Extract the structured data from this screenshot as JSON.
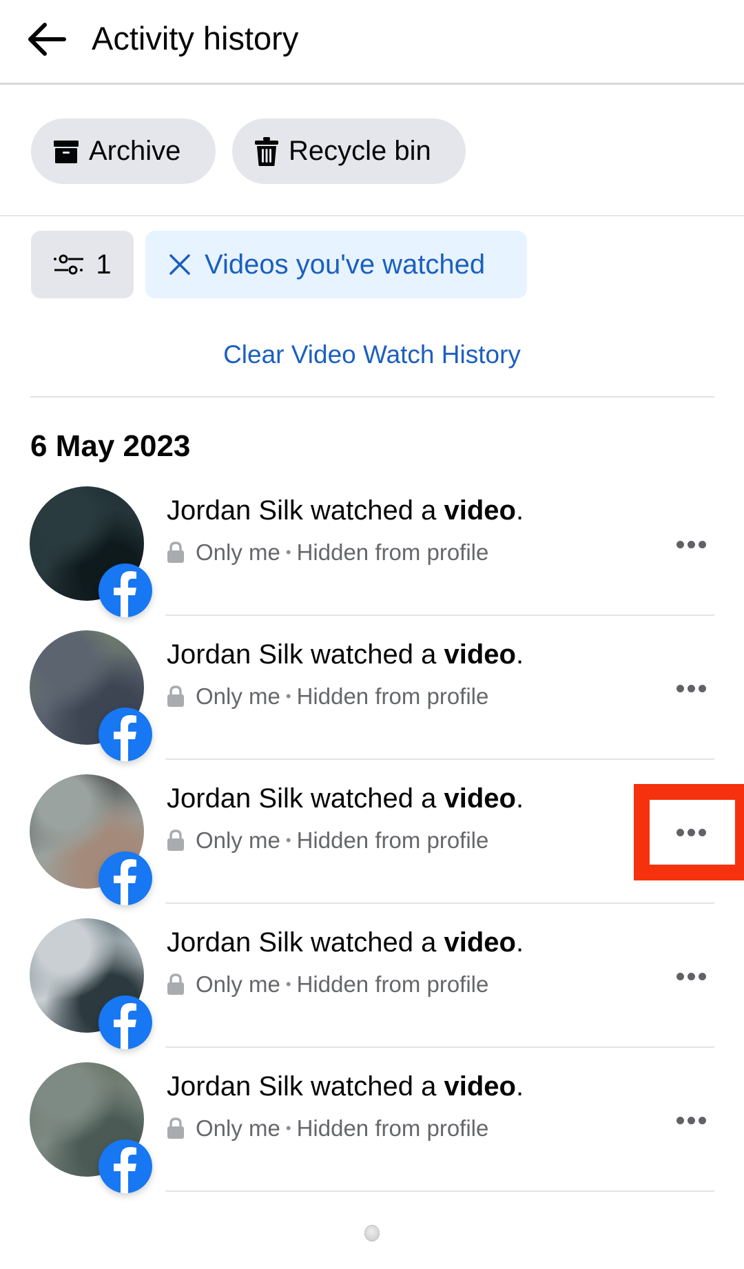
{
  "header": {
    "back_icon": "arrow-left-icon",
    "title": "Activity history"
  },
  "actions": {
    "archive": {
      "label": "Archive",
      "icon": "archive-box-icon"
    },
    "recycle_bin": {
      "label": "Recycle bin",
      "icon": "trash-icon"
    }
  },
  "filters": {
    "filter_button": {
      "icon": "sliders-icon",
      "count": "1"
    },
    "active_chip": {
      "label": "Videos you've watched",
      "icon": "close-icon"
    }
  },
  "clear_link": "Clear Video Watch History",
  "section": {
    "date": "6 May 2023",
    "items": [
      {
        "actor": "Jordan Silk",
        "action": " watched a ",
        "object": "video",
        "suffix": ".",
        "privacy": "Only me",
        "separator": "•",
        "visibility": "Hidden from profile",
        "more_icon": "more-horizontal-icon",
        "thumb_colors": [
          "#1c2b30",
          "#2a3b3f",
          "#0f1a1d"
        ]
      },
      {
        "actor": "Jordan Silk",
        "action": " watched a ",
        "object": "video",
        "suffix": ".",
        "privacy": "Only me",
        "separator": "•",
        "visibility": "Hidden from profile",
        "more_icon": "more-horizontal-icon",
        "thumb_colors": [
          "#7a8a6a",
          "#5c6470",
          "#3d4452"
        ]
      },
      {
        "actor": "Jordan Silk",
        "action": " watched a ",
        "object": "video",
        "suffix": ".",
        "privacy": "Only me",
        "separator": "•",
        "visibility": "Hidden from profile",
        "more_icon": "more-horizontal-icon",
        "thumb_colors": [
          "#2a2a2a",
          "#9aa3a0",
          "#a48a7a"
        ]
      },
      {
        "actor": "Jordan Silk",
        "action": " watched a ",
        "object": "video",
        "suffix": ".",
        "privacy": "Only me",
        "separator": "•",
        "visibility": "Hidden from profile",
        "more_icon": "more-horizontal-icon",
        "thumb_colors": [
          "#3d5660",
          "#c9cfd2",
          "#2c3a40"
        ]
      },
      {
        "actor": "Jordan Silk",
        "action": " watched a ",
        "object": "video",
        "suffix": ".",
        "privacy": "Only me",
        "separator": "•",
        "visibility": "Hidden from profile",
        "more_icon": "more-horizontal-icon",
        "thumb_colors": [
          "#5d6a58",
          "#7e8a84",
          "#4b5a55"
        ]
      }
    ]
  },
  "highlighted_item_index": 2,
  "colors": {
    "brand_blue": "#1877f2",
    "link_blue": "#1b5fbf",
    "chip_bg": "#e7f3ff",
    "pill_bg": "#e4e6eb",
    "highlight_red": "#f5320d"
  }
}
